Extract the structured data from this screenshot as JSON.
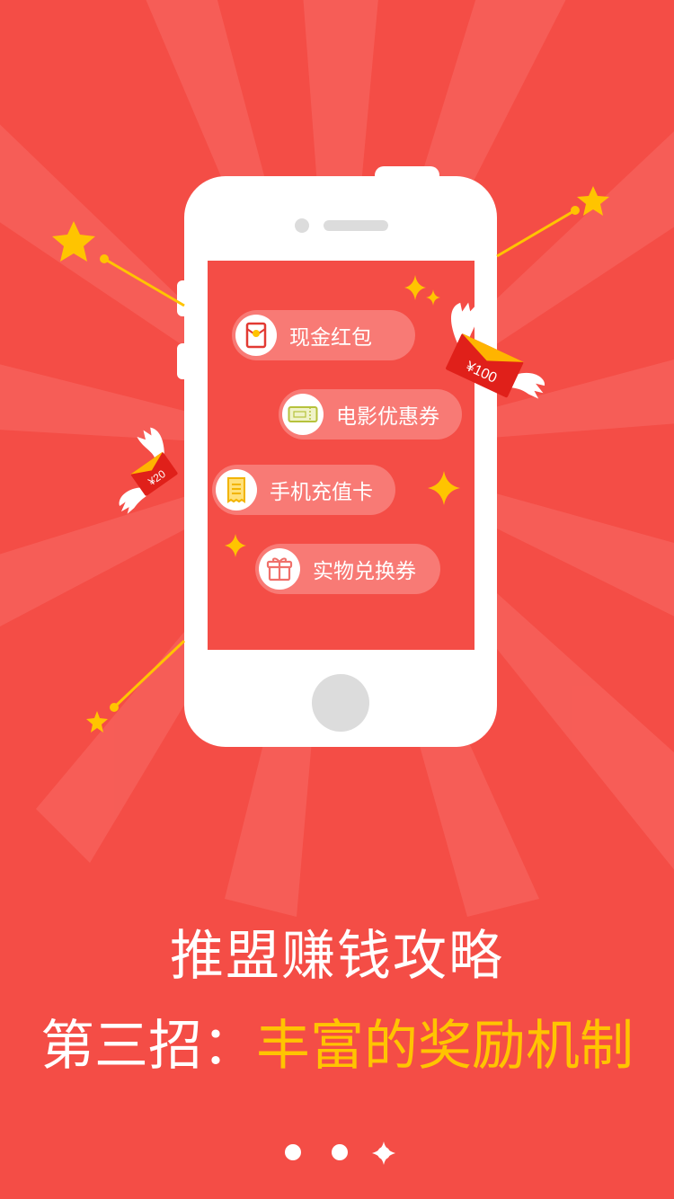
{
  "screen": {
    "headline": "推盟赚钱攻略",
    "subline_prefix": "第三招：",
    "subline_accent": "丰富的奖励机制"
  },
  "phone_menu": [
    {
      "label": "现金红包",
      "icon": "red-envelope-icon"
    },
    {
      "label": "电影优惠券",
      "icon": "movie-ticket-icon"
    },
    {
      "label": "手机充值卡",
      "icon": "recharge-card-icon"
    },
    {
      "label": "实物兑换券",
      "icon": "gift-box-icon"
    }
  ],
  "floating_envelopes": [
    {
      "amount": "¥100"
    },
    {
      "amount": "¥20"
    }
  ],
  "pager": {
    "total": 3,
    "active_index": 2
  },
  "colors": {
    "background": "#f44d46",
    "accent": "#ffc400",
    "pill": "#f87a75"
  }
}
